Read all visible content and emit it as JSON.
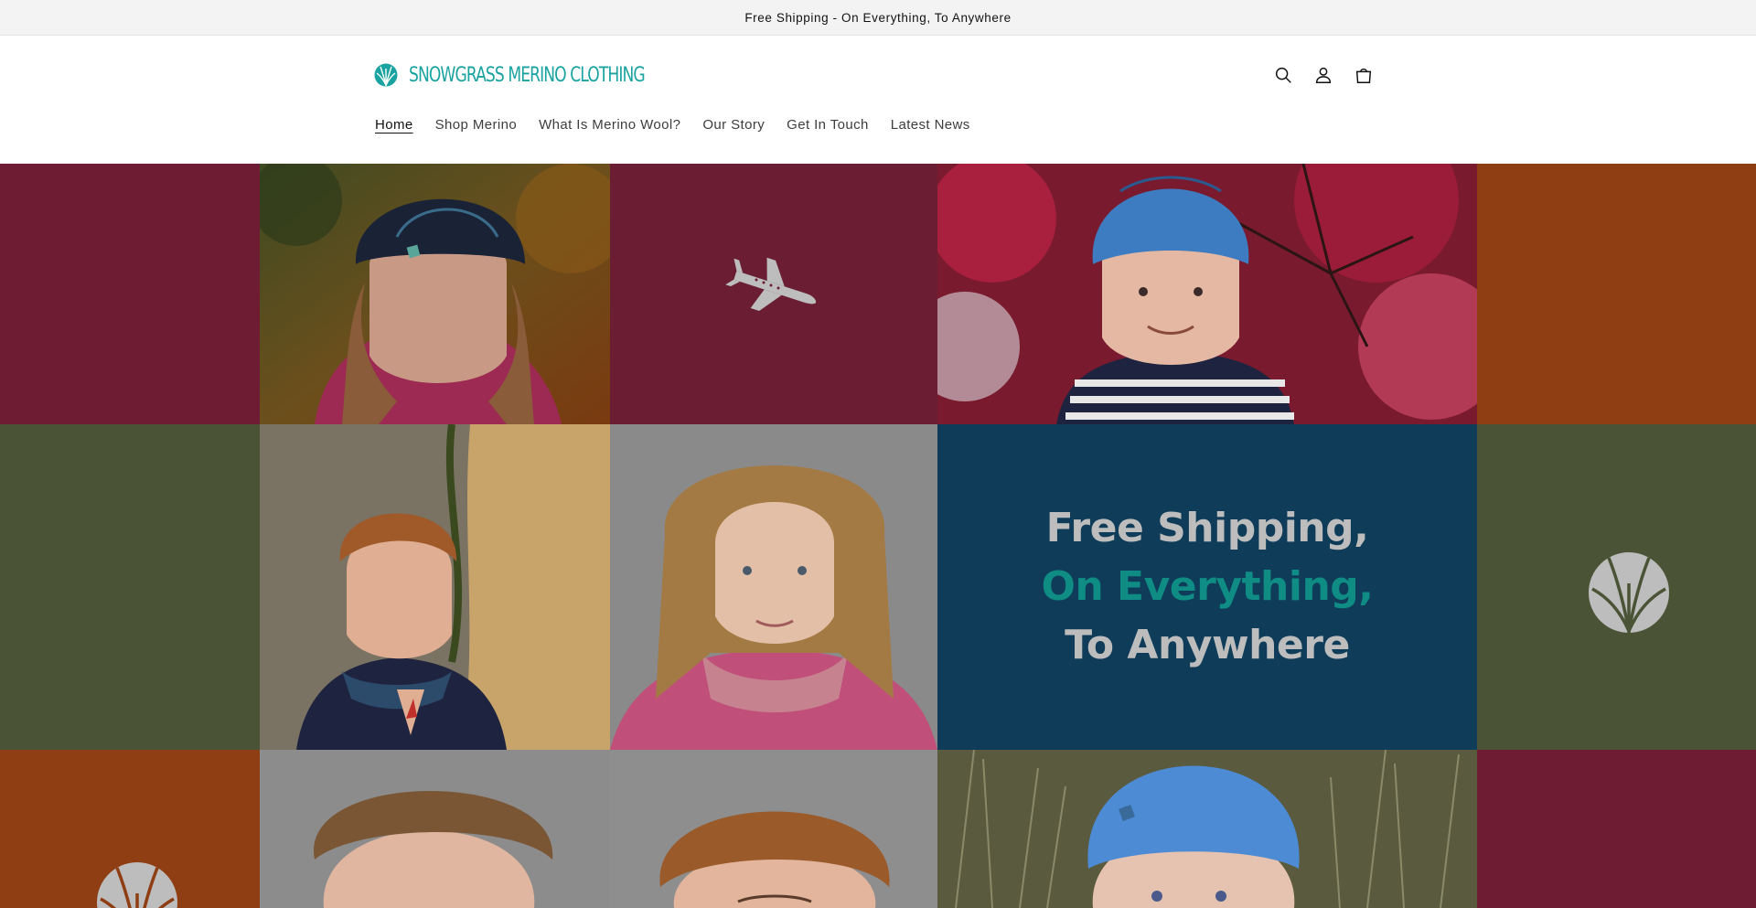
{
  "announcement": {
    "text": "Free Shipping - On Everything, To Anywhere"
  },
  "header": {
    "logo_text": "SNOWGRASS MERINO CLOTHING",
    "icons": [
      "search-icon",
      "account-icon",
      "cart-icon"
    ]
  },
  "nav": {
    "items": [
      {
        "label": "Home",
        "active": true
      },
      {
        "label": "Shop Merino",
        "active": false
      },
      {
        "label": "What Is Merino Wool?",
        "active": false
      },
      {
        "label": "Our Story",
        "active": false
      },
      {
        "label": "Get In Touch",
        "active": false
      },
      {
        "label": "Latest News",
        "active": false
      }
    ]
  },
  "hero": {
    "headline": {
      "line1": "Free Shipping,",
      "line2": "On Everything,",
      "line3": "To Anywhere"
    },
    "photos": [
      "girl-in-navy-beanie-photo",
      "boy-in-blue-beanie-red-leaves-photo",
      "boy-by-tree-trunk-photo",
      "girl-pink-scarf-photo",
      "boy-close-up-photo",
      "smiling-boy-photo",
      "boy-blue-beanie-grass-photo"
    ]
  },
  "colors": {
    "brand_teal": "#1aa3a0",
    "wine": "#6e1b34",
    "orange": "#8e3e12",
    "olive": "#4a5336",
    "navy": "#0e3c59",
    "headline_teal": "#0f8c84"
  }
}
